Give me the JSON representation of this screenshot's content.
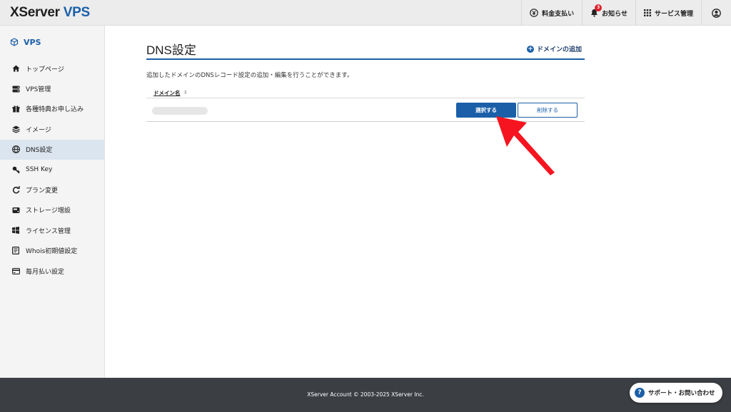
{
  "header": {
    "logo_main": "XServer",
    "logo_sub": " VPS",
    "nav": [
      {
        "label": "料金支払い",
        "icon": "yen-icon"
      },
      {
        "label": "お知らせ",
        "icon": "bell-icon",
        "badge": "3"
      },
      {
        "label": "サービス管理",
        "icon": "grid-icon"
      },
      {
        "label": "",
        "icon": "user-icon"
      }
    ]
  },
  "sidebar": {
    "title": "VPS",
    "items": [
      {
        "label": "トップページ",
        "icon": "home-icon"
      },
      {
        "label": "VPS管理",
        "icon": "server-icon"
      },
      {
        "label": "各種特典お申し込み",
        "icon": "gift-icon"
      },
      {
        "label": "イメージ",
        "icon": "layers-icon"
      },
      {
        "label": "DNS設定",
        "icon": "globe-icon"
      },
      {
        "label": "SSH Key",
        "icon": "key-icon"
      },
      {
        "label": "プラン変更",
        "icon": "refresh-icon"
      },
      {
        "label": "ストレージ増設",
        "icon": "storage-icon"
      },
      {
        "label": "ライセンス管理",
        "icon": "windows-icon"
      },
      {
        "label": "Whois初期値設定",
        "icon": "document-icon"
      },
      {
        "label": "毎月払い設定",
        "icon": "card-icon"
      }
    ],
    "active_index": 4
  },
  "main": {
    "title": "DNS設定",
    "add_domain_label": "ドメインの追加",
    "description": "追加したドメインのDNSレコード設定の追加・編集を行うことができます。",
    "table": {
      "header_domain": "ドメイン名",
      "rows": [
        {
          "select_label": "選択する",
          "delete_label": "削除する"
        }
      ]
    }
  },
  "footer": {
    "copyright": "XServer Account © 2003-2025 XServer Inc.",
    "support_label": "サポート・お問い合わせ"
  },
  "colors": {
    "accent": "#1b5fa8",
    "arrow": "#f5141f",
    "footer_bg": "#3b3f44"
  }
}
